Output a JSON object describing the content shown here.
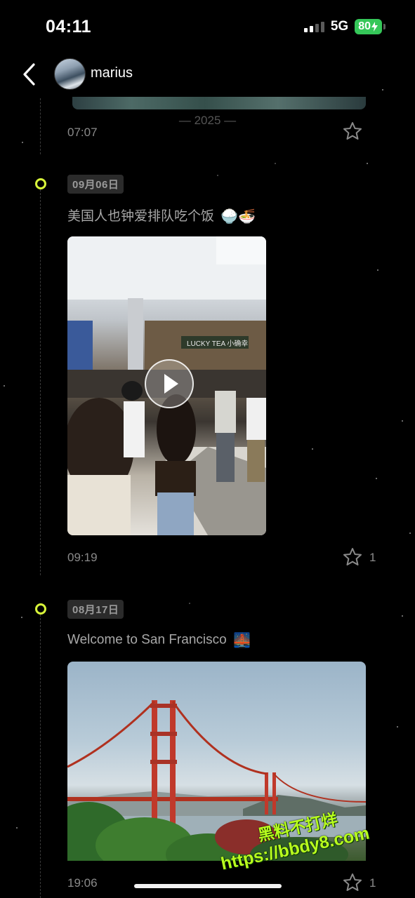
{
  "status_bar": {
    "time": "04:11",
    "network": "5G",
    "battery": "80"
  },
  "header": {
    "username": "marius"
  },
  "timeline": {
    "year_divider": "— 2025 —",
    "previous_entry": {
      "time": "07:07"
    },
    "entries": [
      {
        "date": "09月06日",
        "text": "美国人也钟爱排队吃个饭",
        "emoji": "🍚🍜",
        "media": "video",
        "time": "09:19",
        "likes": "1"
      },
      {
        "date": "08月17日",
        "text": "Welcome to San Francisco",
        "emoji": "🌉",
        "media": "photo",
        "time": "19:06",
        "likes": "1"
      }
    ]
  },
  "video_content": {
    "sign": "LUCKY TEA 小确幸"
  },
  "watermark": {
    "line1": "黑料不打烊",
    "line2": "https://bbdy8.com"
  },
  "colors": {
    "accent_dot": "#d8f53a",
    "battery": "#35c759",
    "watermark": "#b8ff1e"
  }
}
